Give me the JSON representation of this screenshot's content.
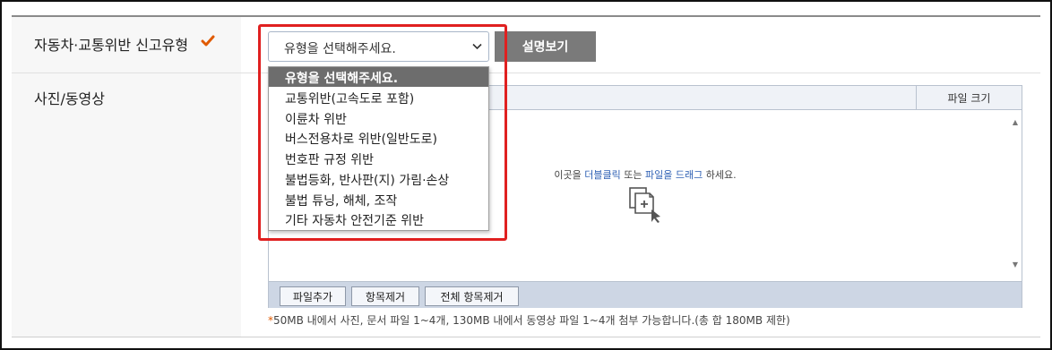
{
  "form": {
    "type_row": {
      "label": "자동차·교통위반 신고유형",
      "check_icon": "checkmark-icon",
      "select": {
        "selected": "유형을 선택해주세요.",
        "options": [
          "유형을 선택해주세요.",
          "교통위반(고속도로 포함)",
          "이륜차 위반",
          "버스전용차로 위반(일반도로)",
          "번호판 규정 위반",
          "불법등화, 반사판(지) 가림·손상",
          "불법 튜닝, 해체, 조작",
          "기타 자동차 안전기준 위반"
        ]
      },
      "desc_button": "설명보기"
    },
    "media_row": {
      "label": "사진/동영상",
      "file_size_header": "파일 크기",
      "drop_hint": {
        "before": "이곳을 ",
        "highlight1": "더블클릭",
        "middle": " 또는 ",
        "highlight2": "파일을 드래그",
        "after": " 하세요."
      },
      "buttons": {
        "add": "파일추가",
        "remove": "항목제거",
        "remove_all": "전체 항목제거"
      },
      "notice_star": "*",
      "notice": "50MB 내에서 사진, 문서 파일 1~4개, 130MB 내에서 동영상 파일 1~4개 첨부 가능합니다.(총 합 180MB 제한)"
    }
  },
  "colors": {
    "accent_check": "#e05a00",
    "highlight": "#e02020",
    "button_gray": "#7a7a7a"
  }
}
